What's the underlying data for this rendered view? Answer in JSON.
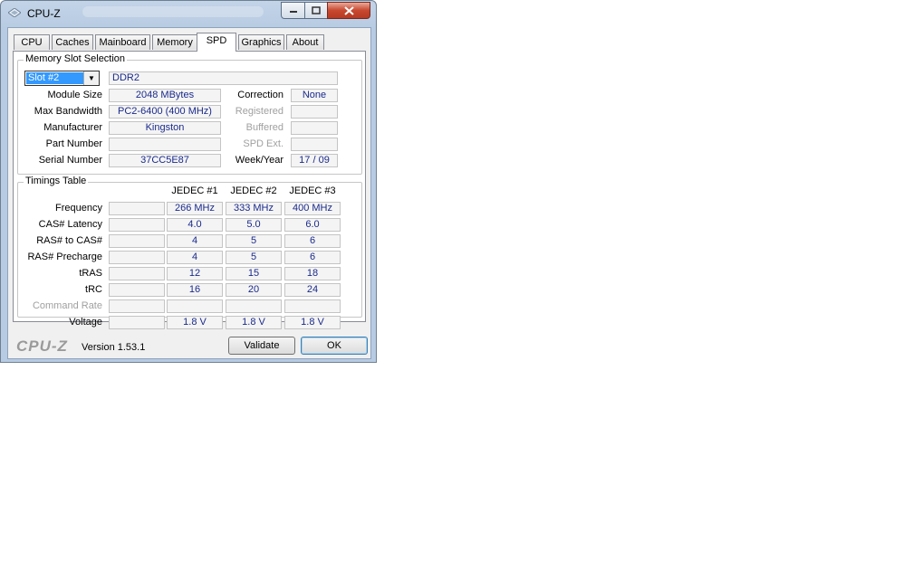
{
  "window": {
    "title": "CPU-Z"
  },
  "tabs": [
    "CPU",
    "Caches",
    "Mainboard",
    "Memory",
    "SPD",
    "Graphics",
    "About"
  ],
  "active_tab": "SPD",
  "slot_section": {
    "title": "Memory Slot Selection",
    "slot_selected": "Slot #2",
    "memory_type": "DDR2",
    "labels": {
      "module_size": "Module Size",
      "max_bandwidth": "Max Bandwidth",
      "manufacturer": "Manufacturer",
      "part_number": "Part Number",
      "serial_number": "Serial Number",
      "correction": "Correction",
      "registered": "Registered",
      "buffered": "Buffered",
      "spd_ext": "SPD Ext.",
      "week_year": "Week/Year"
    },
    "values": {
      "module_size": "2048 MBytes",
      "max_bandwidth": "PC2-6400 (400 MHz)",
      "manufacturer": "Kingston",
      "part_number": "",
      "serial_number": "37CC5E87",
      "correction": "None",
      "registered": "",
      "buffered": "",
      "spd_ext": "",
      "week_year": "17 / 09"
    }
  },
  "timings": {
    "title": "Timings Table",
    "columns": [
      "JEDEC #1",
      "JEDEC #2",
      "JEDEC #3"
    ],
    "rows": [
      {
        "label": "Frequency",
        "values": [
          "266 MHz",
          "333 MHz",
          "400 MHz"
        ]
      },
      {
        "label": "CAS# Latency",
        "values": [
          "4.0",
          "5.0",
          "6.0"
        ]
      },
      {
        "label": "RAS# to CAS#",
        "values": [
          "4",
          "5",
          "6"
        ]
      },
      {
        "label": "RAS# Precharge",
        "values": [
          "4",
          "5",
          "6"
        ]
      },
      {
        "label": "tRAS",
        "values": [
          "12",
          "15",
          "18"
        ]
      },
      {
        "label": "tRC",
        "values": [
          "16",
          "20",
          "24"
        ]
      },
      {
        "label": "Command Rate",
        "values": [
          "",
          "",
          ""
        ]
      },
      {
        "label": "Voltage",
        "values": [
          "1.8 V",
          "1.8 V",
          "1.8 V"
        ]
      }
    ]
  },
  "footer": {
    "logo": "CPU-Z",
    "version": "Version 1.53.1",
    "validate_label": "Validate",
    "ok_label": "OK"
  }
}
